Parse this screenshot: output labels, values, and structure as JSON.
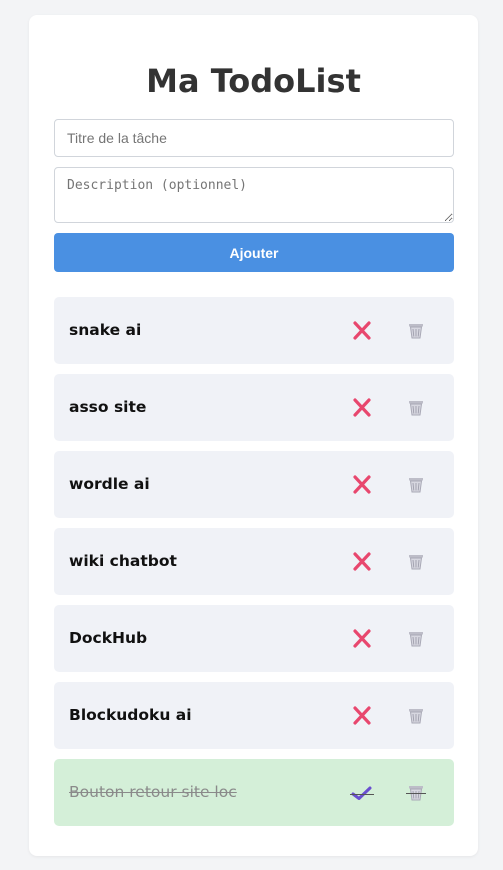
{
  "app": {
    "title": "Ma TodoList"
  },
  "form": {
    "title_placeholder": "Titre de la tâche",
    "title_value": "",
    "description_placeholder": "Description (optionnel)",
    "description_value": "",
    "add_label": "Ajouter"
  },
  "colors": {
    "accent": "#4a90e2",
    "item_bg": "#f0f2f7",
    "done_bg": "#d4efd8",
    "cross": "#e8476e",
    "check": "#6a4fd0"
  },
  "todos": [
    {
      "label": "snake ai",
      "done": false,
      "toggle_icon": "cross-icon",
      "delete_icon": "trash-icon"
    },
    {
      "label": "asso site",
      "done": false,
      "toggle_icon": "cross-icon",
      "delete_icon": "trash-icon"
    },
    {
      "label": "wordle ai",
      "done": false,
      "toggle_icon": "cross-icon",
      "delete_icon": "trash-icon"
    },
    {
      "label": "wiki chatbot",
      "done": false,
      "toggle_icon": "cross-icon",
      "delete_icon": "trash-icon"
    },
    {
      "label": "DockHub",
      "done": false,
      "toggle_icon": "cross-icon",
      "delete_icon": "trash-icon"
    },
    {
      "label": "Blockudoku ai",
      "done": false,
      "toggle_icon": "cross-icon",
      "delete_icon": "trash-icon"
    },
    {
      "label": "Bouton retour site loc",
      "done": true,
      "toggle_icon": "check-icon",
      "delete_icon": "trash-icon"
    }
  ]
}
